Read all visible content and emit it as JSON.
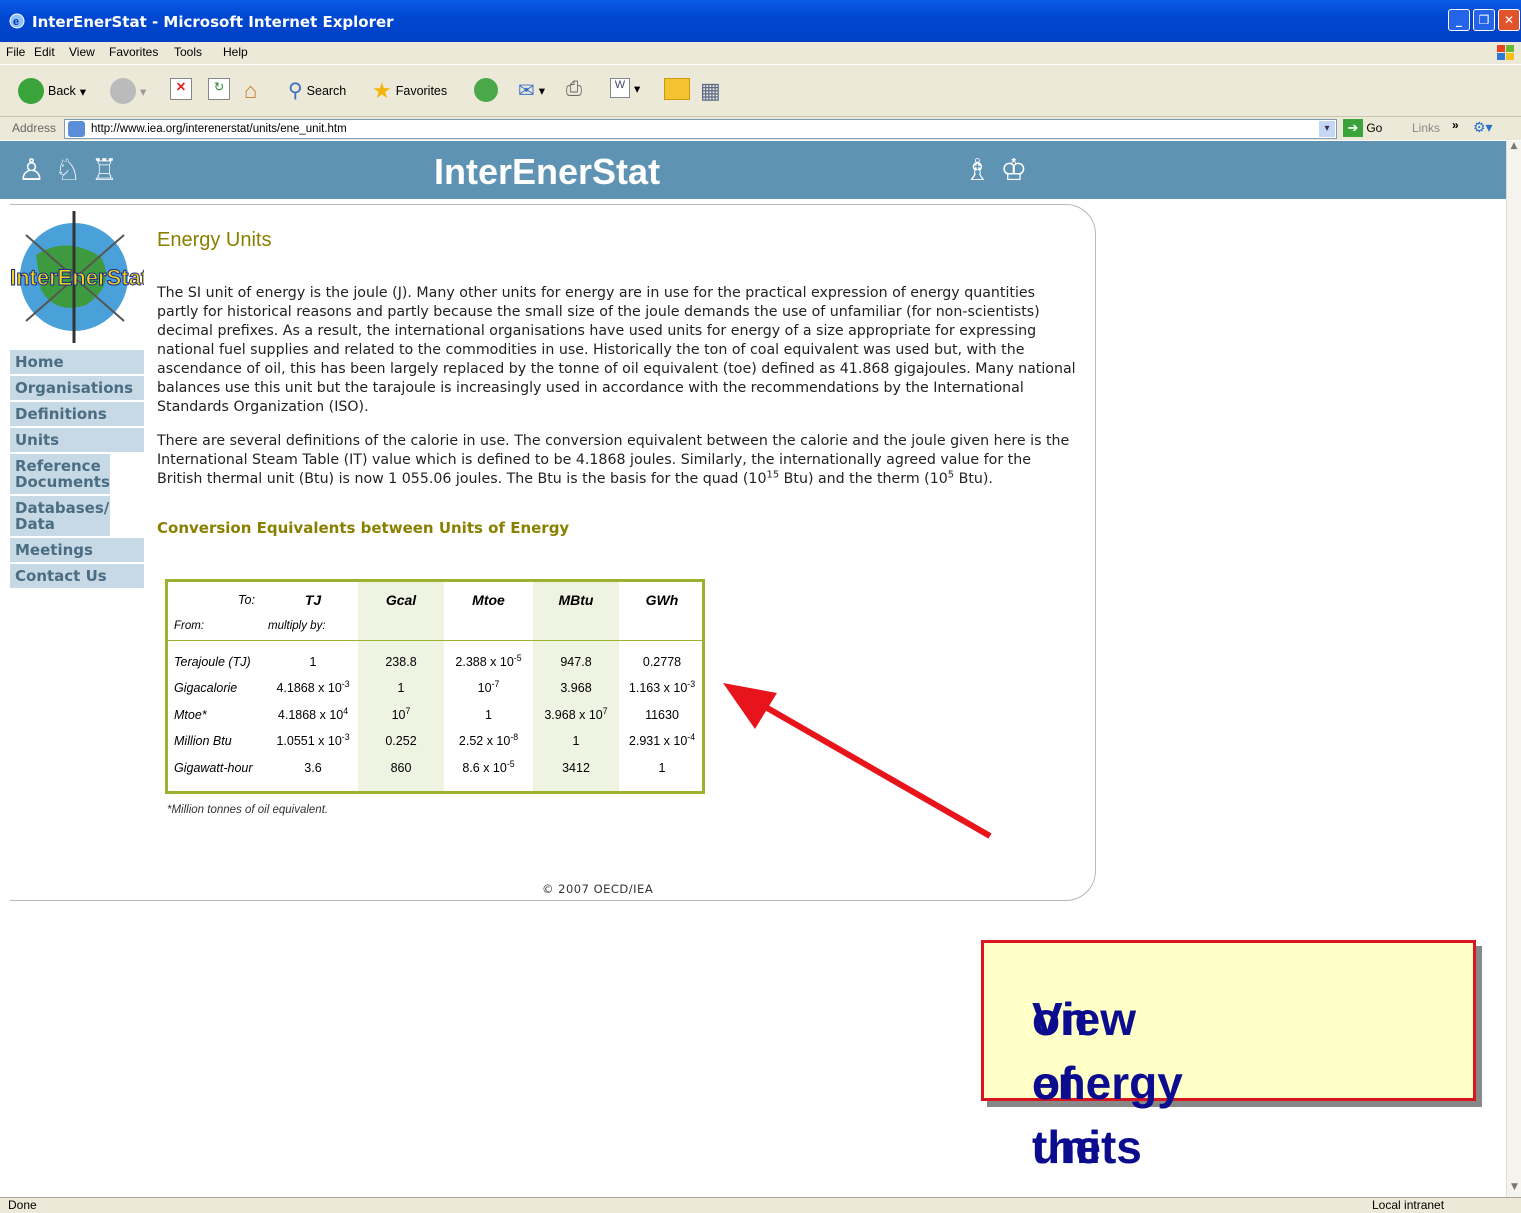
{
  "window": {
    "title": "InterEnerStat - Microsoft Internet Explorer"
  },
  "menu": [
    "File",
    "Edit",
    "View",
    "Favorites",
    "Tools",
    "Help"
  ],
  "toolbar": {
    "back": "Back",
    "search": "Search",
    "favorites": "Favorites"
  },
  "address": {
    "label": "Address",
    "url": "http://www.iea.org/interenerstat/units/ene_unit.htm",
    "go": "Go",
    "links": "Links"
  },
  "site": {
    "banner_title": "InterEnerStat",
    "logo_text": "InterEnerStat"
  },
  "nav": [
    "Home",
    "Organisations",
    "Definitions",
    "Units",
    "Reference Documents",
    "Databases/ Data",
    "Meetings",
    "Contact Us"
  ],
  "content": {
    "heading": "Energy Units",
    "para1": "The SI unit of energy is the joule (J). Many other units for energy are in use for the practical expression of energy quantities partly for historical reasons and partly because the small size of the joule demands the use of unfamiliar (for non-scientists) decimal prefixes. As a result, the international organisations have used units for energy of a size appropriate for expressing national fuel supplies and related to the commodities in use. Historically the ton of coal equivalent was used but, with the ascendance of oil, this has been largely replaced by the tonne of oil equivalent (toe) defined as 41.868 gigajoules. Many national balances use this unit but the tarajoule is increasingly used in accordance with the recommendations by the International Standards Organization (ISO).",
    "para2_a": "There are several definitions of the calorie in use. The conversion equivalent between the calorie and the joule given here is the International Steam Table (IT) value which is defined to be 4.1868 joules. Similarly, the internationally agreed value for the British thermal unit (Btu) is now 1 055.06 joules. The Btu is the basis for the quad (10",
    "para2_sup1": "15",
    "para2_b": " Btu) and the therm (10",
    "para2_sup2": "5",
    "para2_c": " Btu).",
    "table_heading": "Conversion Equivalents between Units of Energy",
    "footnote": "*Million tonnes of oil equivalent.",
    "copyright": "© 2007 OECD/IEA"
  },
  "table": {
    "to_label": "To:",
    "from_label": "From:",
    "multiply_label": "multiply by:",
    "columns": [
      "TJ",
      "Gcal",
      "Mtoe",
      "MBtu",
      "GWh"
    ],
    "rows": [
      {
        "label": "Terajoule (TJ)",
        "cells": [
          "1",
          "238.8",
          "2.388 x 10|-5",
          "947.8",
          "0.2778"
        ]
      },
      {
        "label": "Gigacalorie",
        "cells": [
          "4.1868 x 10|-3",
          "1",
          "10|-7",
          "3.968",
          "1.163 x 10|-3"
        ]
      },
      {
        "label": "Mtoe*",
        "cells": [
          "4.1868 x 10|4",
          "10|7",
          "1",
          "3.968 x 10|7",
          "11630"
        ]
      },
      {
        "label": "Million Btu",
        "cells": [
          "1.0551 x 10|-3",
          "0.252",
          "2.52 x 10|-8",
          "1",
          "2.931 x 10|-4"
        ]
      },
      {
        "label": "Gigawatt-hour",
        "cells": [
          "3.6",
          "860",
          "8.6 x 10|-5",
          "3412",
          "1"
        ]
      }
    ]
  },
  "callout": {
    "line1": "View of the page",
    "line2": "on energy units"
  },
  "status": {
    "left": "Done",
    "right": "Local intranet"
  }
}
